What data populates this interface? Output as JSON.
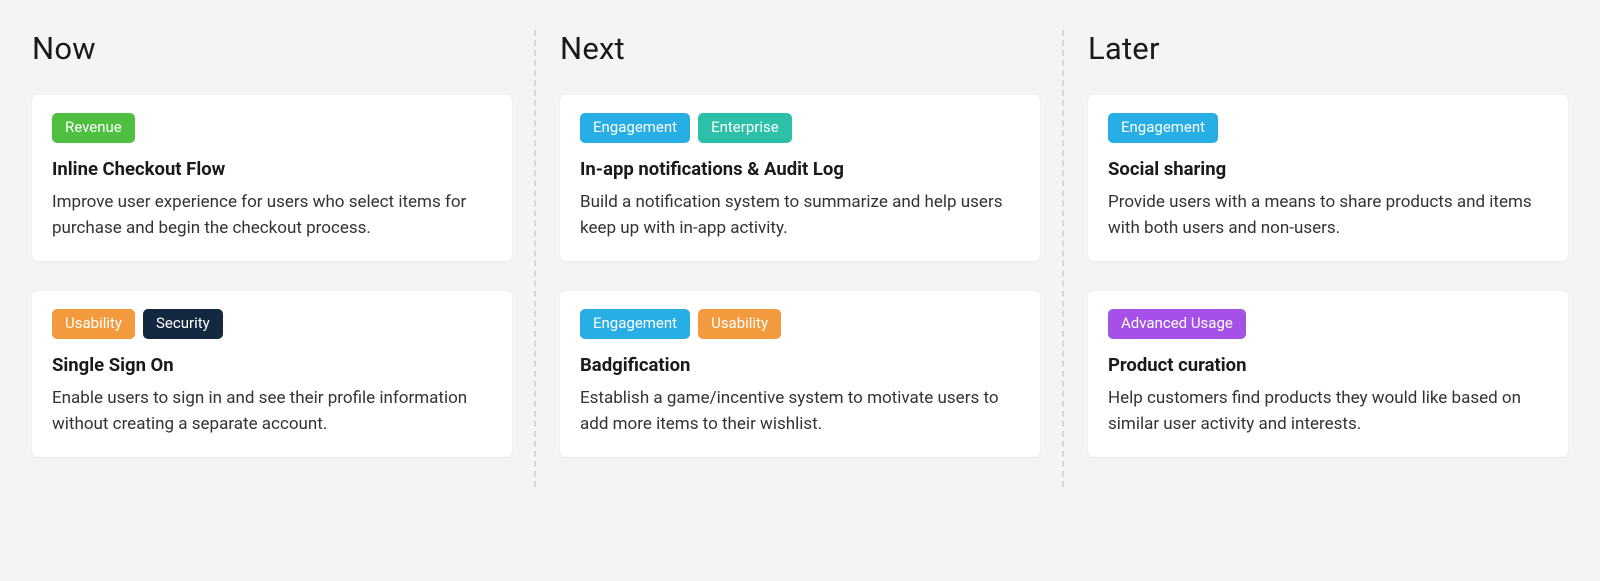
{
  "tagColors": {
    "Revenue": "#4fbf40",
    "Engagement": "#27aee5",
    "Enterprise": "#2cc0a9",
    "Usability": "#f39a3e",
    "Security": "#14293f",
    "Advanced Usage": "#a550e6"
  },
  "columns": [
    {
      "title": "Now",
      "cards": [
        {
          "tags": [
            "Revenue"
          ],
          "title": "Inline Checkout Flow",
          "description": "Improve user experience for users who select items for purchase and begin the checkout process."
        },
        {
          "tags": [
            "Usability",
            "Security"
          ],
          "title": "Single Sign On",
          "description": "Enable users to sign in and see their profile information without creating a separate account."
        }
      ]
    },
    {
      "title": "Next",
      "cards": [
        {
          "tags": [
            "Engagement",
            "Enterprise"
          ],
          "title": "In-app notifications & Audit Log",
          "description": "Build a notification system to summarize and help users keep up with in-app activity."
        },
        {
          "tags": [
            "Engagement",
            "Usability"
          ],
          "title": "Badgification",
          "description": "Establish a game/incentive system to motivate users to add more items to their wishlist."
        }
      ]
    },
    {
      "title": "Later",
      "cards": [
        {
          "tags": [
            "Engagement"
          ],
          "title": "Social sharing",
          "description": "Provide users with a means to share products and items with both users and non-users."
        },
        {
          "tags": [
            "Advanced Usage"
          ],
          "title": "Product curation",
          "description": "Help customers find products they would like based on similar user activity and interests."
        }
      ]
    }
  ]
}
